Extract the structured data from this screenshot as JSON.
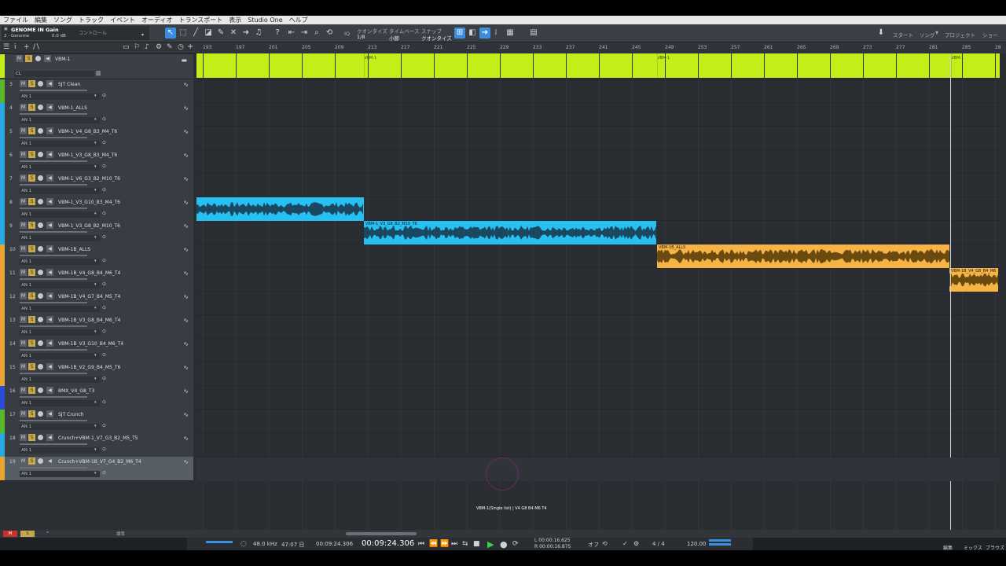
{
  "menu": [
    "ファイル",
    "編集",
    "ソング",
    "トラック",
    "イベント",
    "オーディオ",
    "トランスポート",
    "表示",
    "Studio One",
    "ヘルプ"
  ],
  "instrument": {
    "name": "GENOME IN Gain",
    "sub": "2 - Genome",
    "db": "0.0 dB",
    "control": "コントロール"
  },
  "toolbar": {
    "quantize_label": "クオンタイズ",
    "quantize_val": "1/8",
    "timebase_label": "タイムベース",
    "timebase_val": "小節",
    "snap_label": "スナップ",
    "snap_val": "クオンタイズ",
    "iq": "IQ",
    "start": "スタート",
    "song": "ソング",
    "project": "プロジェクト",
    "show": "ショー"
  },
  "folder_track": {
    "name": "VBM-1",
    "ch": "CL"
  },
  "tracks": [
    {
      "num": "3",
      "name": "SJT Clean",
      "input": "AN 1",
      "color": "#58b82a"
    },
    {
      "num": "4",
      "name": "VBM-1_ALLS",
      "input": "AN 1",
      "color": "#27a9e6"
    },
    {
      "num": "5",
      "name": "VBM-1_V4_G8_B3_M4_T6",
      "input": "AN 1",
      "color": "#27a9e6"
    },
    {
      "num": "6",
      "name": "VBM-1_V3_G8_B3_M4_T6",
      "input": "AN 1",
      "color": "#27a9e6"
    },
    {
      "num": "7",
      "name": "VBM-1_V6_G3_B2_M10_T6",
      "input": "AN 1",
      "color": "#27a9e6"
    },
    {
      "num": "8",
      "name": "VBM-1_V3_G10_B3_M4_T6",
      "input": "AN 1",
      "color": "#27a9e6"
    },
    {
      "num": "9",
      "name": "VBM-1_V3_G8_B2_M10_T6",
      "input": "AN 1",
      "color": "#27a9e6"
    },
    {
      "num": "10",
      "name": "VBM-1B_ALLS",
      "input": "AN 1",
      "color": "#e8a534"
    },
    {
      "num": "11",
      "name": "VBM-1B_V4_G8_B4_M6_T4",
      "input": "AN 1",
      "color": "#e8a534"
    },
    {
      "num": "12",
      "name": "VBM-1B_V4_G7_B4_M5_T4",
      "input": "AN 1",
      "color": "#e8a534"
    },
    {
      "num": "13",
      "name": "VBM-1B_V3_G8_B4_M6_T4",
      "input": "AN 1",
      "color": "#e8a534"
    },
    {
      "num": "14",
      "name": "VBM-1B_V3_G10_B4_M6_T4",
      "input": "AN 1",
      "color": "#e8a534"
    },
    {
      "num": "15",
      "name": "VBM-1B_V2_G9_B4_M5_T6",
      "input": "AN 1",
      "color": "#e8a534"
    },
    {
      "num": "16",
      "name": "BMX_V4_G8_T3",
      "input": "AN 1",
      "color": "#2a4bd7"
    },
    {
      "num": "17",
      "name": "SJT Crunch",
      "input": "AN 1",
      "color": "#58b82a"
    },
    {
      "num": "18",
      "name": "Crunch+VBM-1_V7_G3_B2_M5_T5",
      "input": "AN 1",
      "color": "#27a9e6"
    },
    {
      "num": "19",
      "name": "Crunch+VBM-1B_V7_G4_B2_M6_T4",
      "input": "AN 1",
      "color": "#e8a534"
    }
  ],
  "ruler": [
    "193",
    "197",
    "201",
    "205",
    "209",
    "213",
    "217",
    "221",
    "225",
    "229",
    "233",
    "237",
    "241",
    "245",
    "249",
    "253",
    "257",
    "261",
    "265",
    "269",
    "273",
    "277",
    "281",
    "285",
    "28"
  ],
  "events": {
    "folder": [
      "VBM-1",
      "VBM-1",
      "VBM-1"
    ],
    "e1": "",
    "e2": "VBM-1_V3_G8_B2_M10_T6",
    "e3": "VBM-1B_ALLS",
    "e4": "VBM-1B_V4_G8_B4_M6"
  },
  "drag_hint": "VBM-1(Single list) | V4 G8 B4 M6 T4",
  "bottom": {
    "m": "M",
    "s": "S",
    "std": "標準"
  },
  "transport": {
    "samplerate": "48.0 kHz",
    "rec": "47:07 日",
    "time_small": "00:09:24.306",
    "time_big": "00:09:24.306",
    "l": "L 00:00:16.625",
    "r": "R 00:00:16.875",
    "off": "オフ",
    "sig": "4 / 4",
    "tempo": "120.00",
    "edit": "編集",
    "mix": "ミックス",
    "browse": "ブラウズ"
  },
  "colors": {
    "green": "#c3ee1a",
    "blue": "#27c0f2",
    "orange": "#f5b445",
    "accent": "#3a8ee0"
  }
}
